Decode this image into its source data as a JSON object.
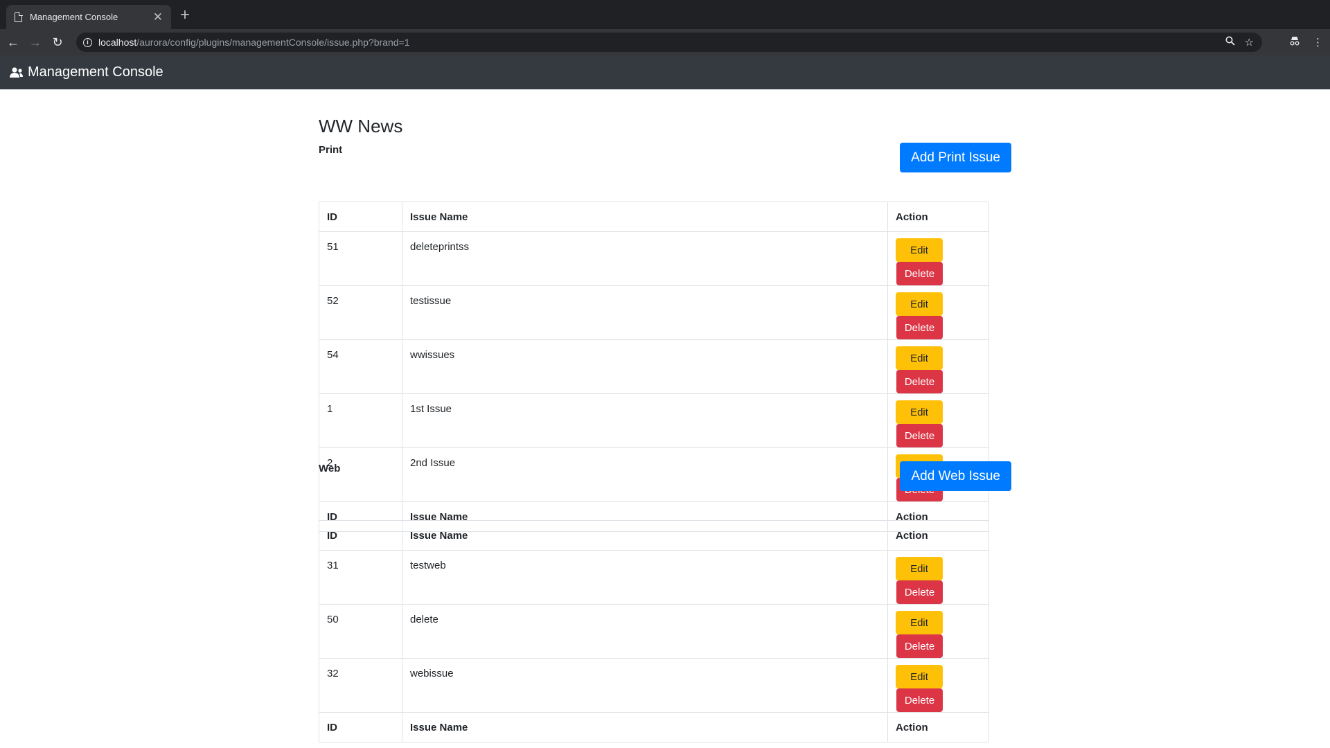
{
  "browser": {
    "tab_title": "Management Console",
    "url_host": "localhost",
    "url_path": "/aurora/config/plugins/managementConsole/issue.php?brand=1"
  },
  "navbar": {
    "brand": "Management Console"
  },
  "page": {
    "title": "WW News"
  },
  "print": {
    "label": "Print",
    "add_button": "Add Print Issue",
    "header": {
      "id": "ID",
      "name": "Issue Name",
      "action": "Action"
    },
    "rows": [
      {
        "id": "51",
        "name": "deleteprintss",
        "edit": "Edit",
        "delete": "Delete"
      },
      {
        "id": "52",
        "name": "testissue",
        "edit": "Edit",
        "delete": "Delete"
      },
      {
        "id": "54",
        "name": "wwissues",
        "edit": "Edit",
        "delete": "Delete"
      },
      {
        "id": "1",
        "name": "1st Issue",
        "edit": "Edit",
        "delete": "Delete"
      },
      {
        "id": "2",
        "name": "2nd Issue",
        "edit": "Edit",
        "delete": "Delete"
      }
    ]
  },
  "web": {
    "label": "Web",
    "add_button": "Add Web Issue",
    "header": {
      "id": "ID",
      "name": "Issue Name",
      "action": "Action"
    },
    "rows": [
      {
        "id": "31",
        "name": "testweb",
        "edit": "Edit",
        "delete": "Delete"
      },
      {
        "id": "50",
        "name": "delete",
        "edit": "Edit",
        "delete": "Delete"
      },
      {
        "id": "32",
        "name": "webissue",
        "edit": "Edit",
        "delete": "Delete"
      }
    ]
  }
}
